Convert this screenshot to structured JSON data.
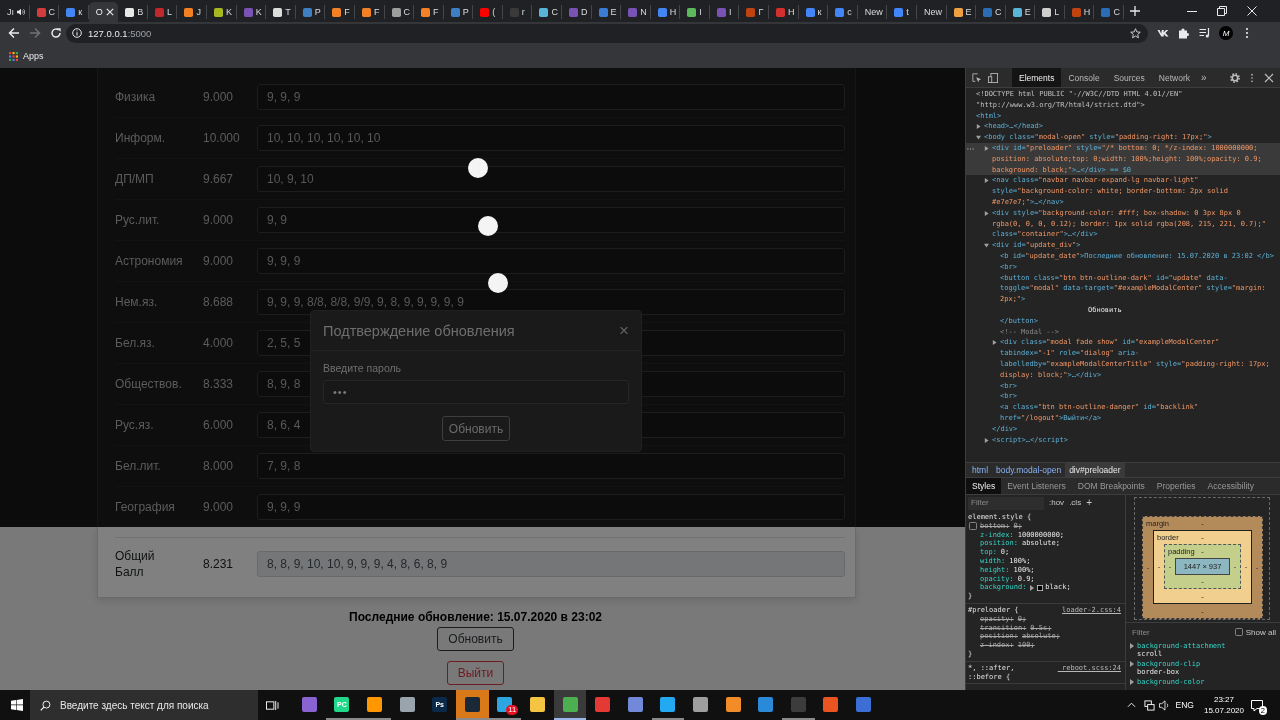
{
  "browser": {
    "tabs": [
      {
        "title": "Jı",
        "selected": false,
        "audio": true
      },
      {
        "title": "C",
        "selected": false,
        "audio": false,
        "color": "#d33c3c"
      },
      {
        "title": "к",
        "selected": false,
        "audio": false,
        "color": "#4285f4"
      },
      {
        "title": "O",
        "selected": true,
        "audio": false
      },
      {
        "title": "B",
        "selected": false,
        "audio": false,
        "color": "#e8e8e8"
      },
      {
        "title": "L",
        "selected": false,
        "audio": false,
        "color": "#c0282d"
      },
      {
        "title": "J",
        "selected": false,
        "audio": false,
        "color": "#f48024"
      },
      {
        "title": "K",
        "selected": false,
        "audio": false,
        "color": "#a8b820"
      },
      {
        "title": "K",
        "selected": false,
        "audio": false,
        "color": "#7952b3"
      },
      {
        "title": "T",
        "selected": false,
        "audio": false,
        "color": "#dcdcdc"
      },
      {
        "title": "P",
        "selected": false,
        "audio": false,
        "color": "#3d7fc1"
      },
      {
        "title": "F",
        "selected": false,
        "audio": false,
        "color": "#f48025"
      },
      {
        "title": "F",
        "selected": false,
        "audio": false,
        "color": "#f48026"
      },
      {
        "title": "C",
        "selected": false,
        "audio": false,
        "color": "#9e9e9e"
      },
      {
        "title": "F",
        "selected": false,
        "audio": false,
        "color": "#f48027"
      },
      {
        "title": "P",
        "selected": false,
        "audio": false,
        "color": "#3d7fc2"
      },
      {
        "title": "(",
        "selected": false,
        "audio": false,
        "color": "#ff0000"
      },
      {
        "title": "r",
        "selected": false,
        "audio": false,
        "color": "#3a3a3a"
      },
      {
        "title": "C",
        "selected": false,
        "audio": false,
        "color": "#59b4d9"
      },
      {
        "title": "D",
        "selected": false,
        "audio": false,
        "color": "#7952b4"
      },
      {
        "title": "E",
        "selected": false,
        "audio": false,
        "color": "#3a7bd5"
      },
      {
        "title": "N",
        "selected": false,
        "audio": false,
        "color": "#7952b5"
      },
      {
        "title": "H",
        "selected": false,
        "audio": false,
        "color": "#4285f5"
      },
      {
        "title": "I",
        "selected": false,
        "audio": false,
        "color": "#5cb85c"
      },
      {
        "title": "I",
        "selected": false,
        "audio": false,
        "color": "#7952b6"
      },
      {
        "title": "Г",
        "selected": false,
        "audio": false,
        "color": "#c1440e"
      },
      {
        "title": "H",
        "selected": false,
        "audio": false,
        "color": "#d32f2f"
      },
      {
        "title": "к",
        "selected": false,
        "audio": false,
        "color": "#4285f6"
      },
      {
        "title": "c",
        "selected": false,
        "audio": false,
        "color": "#4285f7"
      },
      {
        "title": "New",
        "selected": false,
        "audio": false
      },
      {
        "title": "t",
        "selected": false,
        "audio": false,
        "color": "#4285f8"
      },
      {
        "title": "New",
        "selected": false,
        "audio": false
      },
      {
        "title": "E",
        "selected": false,
        "audio": false,
        "color": "#f0a040"
      },
      {
        "title": "C",
        "selected": false,
        "audio": false,
        "color": "#2a6db5"
      },
      {
        "title": "E",
        "selected": false,
        "audio": false,
        "color": "#59b4da"
      },
      {
        "title": "L",
        "selected": false,
        "audio": false,
        "color": "#cfcfcf"
      },
      {
        "title": "H",
        "selected": false,
        "audio": false,
        "color": "#c1440f"
      },
      {
        "title": "C",
        "selected": false,
        "audio": false,
        "color": "#2a6db6"
      }
    ],
    "nav": {
      "forward_disabled": true
    },
    "address": {
      "host": "127.0.0.1",
      "port": ":5000"
    },
    "profile_initial": "M",
    "bookmarks": [
      {
        "label": "Apps"
      }
    ]
  },
  "page": {
    "preloader": {
      "visible": true
    },
    "grades": {
      "rows": [
        {
          "subject": "Физика",
          "average": "9.000",
          "marks": "9, 9, 9"
        },
        {
          "subject": "Информ.",
          "average": "10.000",
          "marks": "10, 10, 10, 10, 10, 10"
        },
        {
          "subject": "ДП/МП",
          "average": "9.667",
          "marks": "10, 9, 10"
        },
        {
          "subject": "Рус.лит.",
          "average": "9.000",
          "marks": "9, 9"
        },
        {
          "subject": "Астрономия",
          "average": "9.000",
          "marks": "9, 9, 9"
        },
        {
          "subject": "Нем.яз.",
          "average": "8.688",
          "marks": "9, 9, 9, 8/8, 8/8, 9/9, 9, 8, 9, 9, 9, 9, 9"
        },
        {
          "subject": "Бел.яз.",
          "average": "4.000",
          "marks": "2, 5, 5"
        },
        {
          "subject": "Обществов.",
          "average": "8.333",
          "marks": "8, 9, 8"
        },
        {
          "subject": "Рус.яз.",
          "average": "6.000",
          "marks": "8, 6, 4"
        },
        {
          "subject": "Бел.лит.",
          "average": "8.000",
          "marks": "7, 9, 8"
        },
        {
          "subject": "География",
          "average": "9.000",
          "marks": "9, 9, 9"
        }
      ],
      "total": {
        "subject": "Общий Балл",
        "average": "8.231",
        "marks": "8, 8, 9, 10, 10, 9, 9, 9, 4, 8, 6, 8, 9"
      }
    },
    "modal": {
      "open": true,
      "title": "Подтверждение обновления",
      "close": "×",
      "label": "Введите пароль",
      "value": "•••",
      "button": "Обновить"
    },
    "update": {
      "text": "Последние обновление: 15.07.2020 в 23:02",
      "button": "Обновить",
      "logout": "Выйти"
    }
  },
  "devtools": {
    "tabs": [
      {
        "label": "Elements",
        "selected": true
      },
      {
        "label": "Console",
        "selected": false
      },
      {
        "label": "Sources",
        "selected": false
      },
      {
        "label": "Network",
        "selected": false
      }
    ],
    "more": "»",
    "dom": [
      {
        "kind": "doctype",
        "text": "<!DOCTYPE html PUBLIC \"-//W3C//DTD HTML 4.01//EN\" \"http://www.w3.org/TR/html4/strict.dtd\">",
        "selected": false
      },
      {
        "kind": "element",
        "text": "<html>",
        "selected": false,
        "children": [
          {
            "kind": "element",
            "text": "<head>…</head>",
            "selected": false,
            "expanded": false
          },
          {
            "kind": "element",
            "text": "<body class=\"modal-open\" style=\"padding-right: 17px;\">",
            "selected": false,
            "expanded": true,
            "children": [
              {
                "kind": "element",
                "text": "<div id=\"preloader\" style=\"/* bottom: 0; */z-index: 1000000000; position: absolute;top: 0;width: 100%;height: 100%;opacity: 0.9; background: black;\">…</div> == $0",
                "selected": true,
                "expanded": false
              },
              {
                "kind": "element",
                "text": "<nav class=\"navbar navbar-expand-lg navbar-light\" style=\"background-color: white; border-bottom: 2px solid #e7e7e7;\">…</nav>",
                "selected": false,
                "expanded": false
              },
              {
                "kind": "element",
                "text": "<div style=\"background-color: #fff; box-shadow: 0 3px 8px 0 rgba(0, 0, 0, 0.12); border: 1px solid rgba(208, 215, 221, 0.7);\" class=\"container\">…</div>",
                "selected": false,
                "expanded": false
              },
              {
                "kind": "element",
                "text": "<div id=\"update_div\">",
                "selected": false,
                "expanded": true,
                "children": [
                  {
                    "kind": "element",
                    "text": "<b id=\"update_date\">Последние обновление: 15.07.2020 в 23:02 </b>",
                    "selected": false
                  },
                  {
                    "kind": "element",
                    "text": "<br>",
                    "selected": false
                  },
                  {
                    "kind": "element",
                    "text": "<button class=\"btn btn-outline-dark\" id=\"update\" data-toggle=\"modal\" data-target=\"#exampleModalCenter\" style=\"margin: 2px;\">",
                    "selected": false,
                    "children": [
                      {
                        "kind": "text",
                        "text": "Обновить",
                        "selected": false
                      }
                    ],
                    "close": "</button>"
                  },
                  {
                    "kind": "comment",
                    "text": "<!-- Modal -->",
                    "selected": false
                  },
                  {
                    "kind": "element",
                    "text": "<div class=\"modal fade show\" id=\"exampleModalCenter\" tabindex=\"-1\" role=\"dialog\" aria-labelledby=\"exampleModalCenterTitle\" style=\"padding-right: 17px; display: block;\">…</div>",
                    "selected": false,
                    "expanded": false
                  },
                  {
                    "kind": "element",
                    "text": "<br>",
                    "selected": false
                  },
                  {
                    "kind": "element",
                    "text": "<br>",
                    "selected": false
                  },
                  {
                    "kind": "element",
                    "text": "<a class=\"btn btn-outline-danger\" id=\"backlink\" href=\"/logout\">Выйти</a>",
                    "selected": false
                  }
                ],
                "close": "</div>"
              },
              {
                "kind": "element",
                "text": "<script>…</script>",
                "selected": false,
                "expanded": false
              }
            ]
          }
        ]
      }
    ],
    "breadcrumbs": [
      {
        "label": "html",
        "selected": false
      },
      {
        "label": "body.modal-open",
        "selected": false
      },
      {
        "label": "div#preloader",
        "selected": true
      }
    ],
    "panel_tabs": [
      {
        "label": "Styles",
        "selected": true
      },
      {
        "label": "Event Listeners",
        "selected": false
      },
      {
        "label": "DOM Breakpoints",
        "selected": false
      },
      {
        "label": "Properties",
        "selected": false
      },
      {
        "label": "Accessibility",
        "selected": false
      }
    ],
    "styles": {
      "filter_placeholder": "Filter",
      "hov": ":hov",
      "cls": ".cls",
      "add": "+",
      "rules": [
        {
          "selector": "element.style {",
          "declarations": [
            {
              "kind": "checkbox",
              "checked": false,
              "struck": true,
              "property": "bottom:",
              "value": "0;"
            },
            {
              "kind": "plain",
              "struck": false,
              "property": "z-index:",
              "value": "1000000000;"
            },
            {
              "kind": "plain",
              "struck": false,
              "property": "position:",
              "value": "absolute;"
            },
            {
              "kind": "plain",
              "struck": false,
              "property": "top:",
              "value": "0;"
            },
            {
              "kind": "plain",
              "struck": false,
              "property": "width:",
              "value": "100%;"
            },
            {
              "kind": "plain",
              "struck": false,
              "property": "height:",
              "value": "100%;"
            },
            {
              "kind": "plain",
              "struck": false,
              "property": "opacity:",
              "value": "0.9;"
            },
            {
              "kind": "shorthand",
              "struck": false,
              "property": "background:",
              "value": "black;",
              "color": "#000000"
            }
          ],
          "close": "}"
        },
        {
          "selector": "#preloader {",
          "source": "loader-2.css:4",
          "declarations": [
            {
              "kind": "plain",
              "struck": true,
              "property": "opacity:",
              "value": "0;"
            },
            {
              "kind": "plain",
              "struck": true,
              "property": "transition:",
              "value": "0.5s;"
            },
            {
              "kind": "plain",
              "struck": true,
              "property": "position:",
              "value": "absolute;"
            },
            {
              "kind": "plain",
              "struck": true,
              "property": "z-index:",
              "value": "100;"
            }
          ],
          "close": "}"
        },
        {
          "selector": "*, ::after, ::before {",
          "source": "_reboot.scss:24"
        }
      ]
    },
    "box_model": {
      "margin": {
        "label": "margin",
        "top": "-",
        "left": "-",
        "border": {
          "label": "border",
          "top": "-",
          "left": "-",
          "padding": {
            "label": "padding",
            "top": "-",
            "left": "-",
            "content": "1447 × 937",
            "right": "-",
            "bottom": "-"
          },
          "right": "-",
          "bottom": "-"
        },
        "right": "-",
        "bottom": "-"
      }
    },
    "computed": {
      "filter_placeholder": "Filter",
      "show_all": {
        "label": "Show all",
        "checked": false
      },
      "properties": [
        {
          "name": "background-attachment",
          "value": "scroll"
        },
        {
          "name": "background-clip",
          "value": "border-box"
        },
        {
          "name": "background-color"
        }
      ]
    }
  },
  "taskbar": {
    "search_placeholder": "Введите здесь текст для поиска",
    "apps": [
      {
        "color": "#8a63d2",
        "running": false,
        "selected": false,
        "attention": false
      },
      {
        "color": "#21d789",
        "label": "PC",
        "running": true,
        "selected": false,
        "attention": false
      },
      {
        "color": "#ff9800",
        "running": true,
        "selected": false,
        "attention": false
      },
      {
        "color": "#9aa4ad",
        "running": false,
        "selected": false,
        "attention": false
      },
      {
        "color": "#0b2a4a",
        "label": "Ps",
        "running": false,
        "selected": false,
        "attention": false
      },
      {
        "color": "#1b2838",
        "running": true,
        "selected": false,
        "attention": true
      },
      {
        "color": "#2ca5e0",
        "badge": "11",
        "running": true,
        "selected": false,
        "attention": false
      },
      {
        "color": "#f4c542",
        "running": false,
        "selected": false,
        "attention": false
      },
      {
        "color": "#4caf50",
        "running": true,
        "selected": true,
        "attention": false
      },
      {
        "color": "#e53935",
        "running": false,
        "selected": false,
        "attention": false
      },
      {
        "color": "#7289da",
        "running": false,
        "selected": false,
        "attention": false
      },
      {
        "color": "#23a9f2",
        "running": true,
        "selected": false,
        "attention": false
      },
      {
        "color": "#9e9e9f",
        "running": false,
        "selected": false,
        "attention": false
      },
      {
        "color": "#f28c28",
        "running": false,
        "selected": false,
        "attention": false
      },
      {
        "color": "#2b8ad8",
        "running": false,
        "selected": false,
        "attention": false
      },
      {
        "color": "#3c3c3c",
        "running": true,
        "selected": false,
        "attention": false
      },
      {
        "color": "#e95420",
        "running": false,
        "selected": false,
        "attention": false
      },
      {
        "color": "#3b6fd6",
        "running": false,
        "selected": false,
        "attention": false
      }
    ],
    "language": "ENG",
    "time": "23:27",
    "date": "15.07.2020",
    "notifications": "2"
  }
}
